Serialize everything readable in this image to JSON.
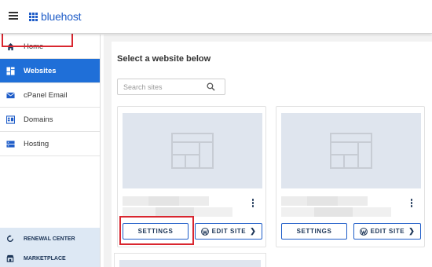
{
  "header": {
    "brand": "bluehost"
  },
  "sidebar": {
    "items": [
      {
        "label": "Home",
        "icon": "home-icon"
      },
      {
        "label": "Websites",
        "icon": "grid-icon",
        "active": true
      },
      {
        "label": "cPanel Email",
        "icon": "mail-icon"
      },
      {
        "label": "Domains",
        "icon": "domains-icon"
      },
      {
        "label": "Hosting",
        "icon": "server-icon"
      }
    ],
    "bottom": [
      {
        "label": "RENEWAL CENTER",
        "icon": "refresh-icon"
      },
      {
        "label": "MARKETPLACE",
        "icon": "store-icon"
      }
    ]
  },
  "main": {
    "title": "Select a website below",
    "search": {
      "placeholder": "Search sites",
      "value": ""
    },
    "cards": [
      {
        "settings_label": "SETTINGS",
        "edit_label": "EDIT SITE"
      },
      {
        "settings_label": "SETTINGS",
        "edit_label": "EDIT SITE"
      }
    ]
  },
  "colors": {
    "brand": "#1f5dc8",
    "active_nav": "#1f6fd8",
    "highlight": "#d9262f",
    "thumb": "#dfe5ee"
  }
}
